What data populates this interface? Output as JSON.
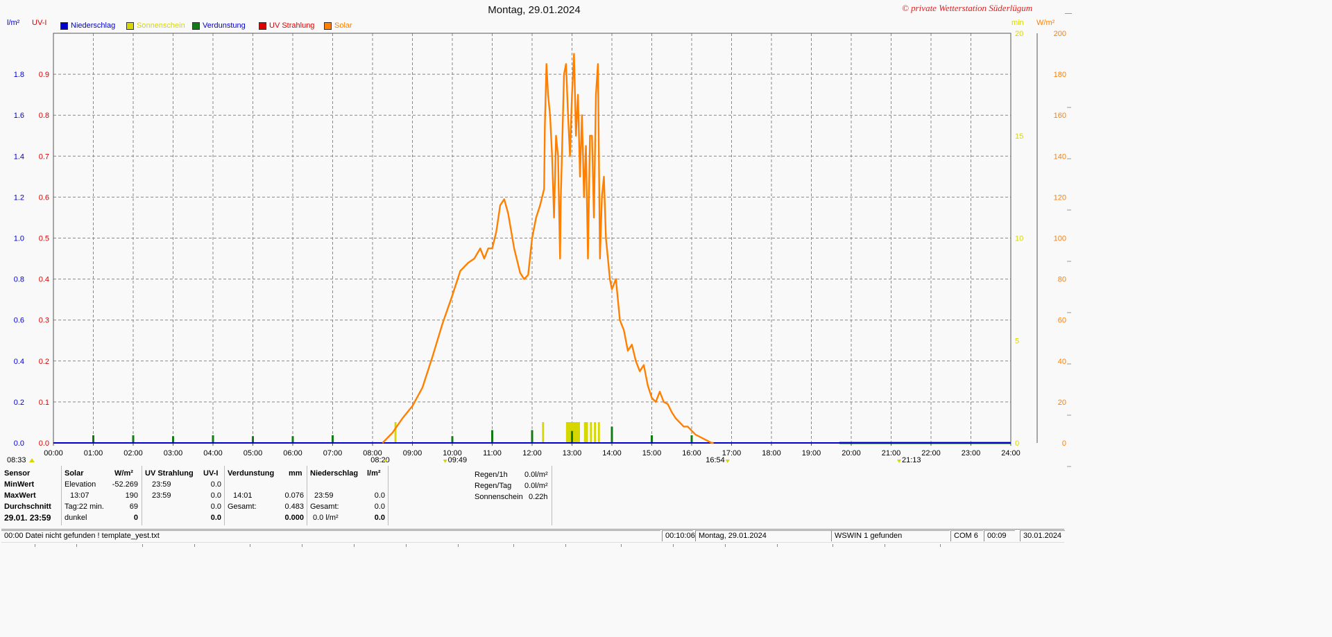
{
  "chart_data": {
    "type": "line",
    "title": "Montag, 29.01.2024",
    "copyright": "© private Wetterstation Süderlügum",
    "legend": [
      {
        "label": "Niederschlag",
        "color": "#0000cc"
      },
      {
        "label": "Sonnenschein",
        "color": "#d7d700"
      },
      {
        "label": "Verdunstung",
        "color": "#137a13"
      },
      {
        "label": "UV Strahlung",
        "color": "#dd0000"
      },
      {
        "label": "Solar",
        "color": "#ff8000"
      }
    ],
    "axes": {
      "left1": {
        "unit": "l/m²",
        "color": "#0000cc",
        "ticks": [
          "0.0",
          "0.2",
          "0.4",
          "0.6",
          "0.8",
          "1.0",
          "1.2",
          "1.4",
          "1.6",
          "1.8"
        ],
        "range": [
          0,
          2
        ]
      },
      "left2": {
        "unit": "UV-I",
        "color": "#dd0000",
        "ticks": [
          "0.0",
          "0.1",
          "0.2",
          "0.3",
          "0.4",
          "0.5",
          "0.6",
          "0.7",
          "0.8",
          "0.9"
        ],
        "range": [
          0,
          1
        ]
      },
      "right1": {
        "unit": "min",
        "color": "#d7d700",
        "ticks": [
          "0",
          "5",
          "10",
          "15",
          "20"
        ],
        "range": [
          0,
          20
        ]
      },
      "right2": {
        "unit": "W/m²",
        "color": "#ff8000",
        "ticks": [
          "0",
          "20",
          "40",
          "60",
          "80",
          "100",
          "120",
          "140",
          "160",
          "180",
          "200"
        ],
        "range": [
          0,
          200
        ]
      },
      "x": {
        "ticks": [
          "00:00",
          "01:00",
          "02:00",
          "03:00",
          "04:00",
          "05:00",
          "06:00",
          "07:00",
          "08:00",
          "09:00",
          "10:00",
          "11:00",
          "12:00",
          "13:00",
          "14:00",
          "15:00",
          "16:00",
          "17:00",
          "18:00",
          "19:00",
          "20:00",
          "21:00",
          "22:00",
          "23:00",
          "24:00"
        ],
        "range": [
          0,
          24
        ]
      }
    },
    "grid": true,
    "markers": {
      "sunrise": "08:33",
      "dawn": "08:20",
      "solar_noon_markers": [
        "09:49",
        "16:54",
        "21:13"
      ]
    },
    "series": [
      {
        "name": "Solar",
        "color": "#ff8000",
        "unit": "W/m²",
        "x": [
          8.25,
          8.5,
          8.75,
          9.0,
          9.25,
          9.5,
          9.75,
          10.0,
          10.2,
          10.4,
          10.55,
          10.7,
          10.8,
          10.9,
          11.0,
          11.1,
          11.2,
          11.3,
          11.4,
          11.55,
          11.7,
          11.8,
          11.9,
          12.0,
          12.1,
          12.2,
          12.3,
          12.32,
          12.36,
          12.4,
          12.45,
          12.5,
          12.55,
          12.6,
          12.65,
          12.7,
          12.72,
          12.76,
          12.8,
          12.85,
          12.9,
          12.95,
          13.0,
          13.05,
          13.1,
          13.15,
          13.2,
          13.25,
          13.3,
          13.35,
          13.4,
          13.45,
          13.5,
          13.55,
          13.6,
          13.65,
          13.7,
          13.75,
          13.8,
          13.85,
          13.9,
          13.95,
          14.0,
          14.1,
          14.2,
          14.3,
          14.4,
          14.5,
          14.6,
          14.7,
          14.8,
          14.9,
          15.0,
          15.1,
          15.2,
          15.3,
          15.4,
          15.5,
          15.6,
          15.7,
          15.8,
          15.9,
          16.0,
          16.1,
          16.2,
          16.3,
          16.4,
          16.5,
          16.55
        ],
        "y": [
          0,
          5,
          12,
          18,
          27,
          42,
          58,
          72,
          84,
          88,
          90,
          95,
          90,
          95,
          95,
          103,
          116,
          119,
          112,
          95,
          83,
          80,
          82,
          100,
          110,
          116,
          124,
          155,
          185,
          170,
          160,
          140,
          110,
          150,
          140,
          90,
          120,
          150,
          180,
          185,
          160,
          140,
          170,
          190,
          150,
          170,
          130,
          160,
          120,
          145,
          90,
          150,
          150,
          110,
          170,
          185,
          90,
          120,
          130,
          100,
          90,
          80,
          75,
          80,
          60,
          55,
          45,
          48,
          40,
          35,
          38,
          28,
          22,
          20,
          25,
          20,
          19,
          15,
          12,
          10,
          8,
          8,
          6,
          4,
          3,
          2,
          1,
          0,
          0
        ]
      },
      {
        "name": "Sonnenschein",
        "color": "#d7d700",
        "unit": "min",
        "intervals": [
          [
            8.55,
            8.6
          ],
          [
            12.25,
            12.3
          ],
          [
            12.85,
            13.2
          ],
          [
            13.3,
            13.4
          ],
          [
            13.45,
            13.5
          ],
          [
            13.55,
            13.6
          ],
          [
            13.65,
            13.7
          ]
        ]
      },
      {
        "name": "Verdunstung",
        "color": "#137a13",
        "unit": "mm",
        "x": [
          1,
          2,
          3,
          4,
          5,
          6,
          7,
          10,
          11,
          12,
          13,
          14,
          15,
          16
        ],
        "y": [
          0.02,
          0.02,
          0.015,
          0.02,
          0.015,
          0.015,
          0.02,
          0.015,
          0.05,
          0.05,
          0.045,
          0.07,
          0.02,
          0.02
        ]
      },
      {
        "name": "Niederschlag",
        "color": "#0000cc",
        "unit": "l/m²",
        "x": [
          0,
          24
        ],
        "y": [
          0,
          0
        ]
      }
    ]
  },
  "stats": {
    "labels": {
      "sensor": "Sensor",
      "minwert": "MinWert",
      "maxwert": "MaxWert",
      "durchschnitt": "Durchschnitt",
      "datetime": "29.01. 23:59"
    },
    "solar": {
      "header": "Solar",
      "unit": "W/m²",
      "min_label": "Elevation",
      "min": "-52.269",
      "max_time": "13:07",
      "max": "190",
      "avg_label": "Tag:22 min.",
      "avg": "69",
      "now_label": "dunkel",
      "now": "0"
    },
    "uv": {
      "header": "UV Strahlung",
      "unit": "UV-I",
      "min_time": "23:59",
      "min": "0.0",
      "max_time": "23:59",
      "max": "0.0",
      "avg": "0.0",
      "now": "0.0"
    },
    "evap": {
      "header": "Verdunstung",
      "unit": "mm",
      "max_time": "14:01",
      "max": "0.076",
      "total_label": "Gesamt:",
      "total": "0.483",
      "now": "0.000"
    },
    "rain": {
      "header": "Niederschlag",
      "unit": "l/m²",
      "max_time": "23:59",
      "max": "0.0",
      "total_label": "Gesamt:",
      "total": "0.0",
      "now_label": "0.0 l/m²",
      "now": "0.0"
    },
    "extra": {
      "rain_1h_label": "Regen/1h",
      "rain_1h": "0.0l/m²",
      "rain_day_label": "Regen/Tag",
      "rain_day": "0.0l/m²",
      "sun_label": "Sonnenschein",
      "sun": "0.22h"
    }
  },
  "statusbar": {
    "message": "00:00  Datei nicht gefunden ! template_yest.txt",
    "elapsed": "00:10:06",
    "date": "Montag, 29.01.2024",
    "device": "WSWIN 1 gefunden",
    "port": "COM 6",
    "time": "00:09",
    "date2": "30.01.2024"
  }
}
